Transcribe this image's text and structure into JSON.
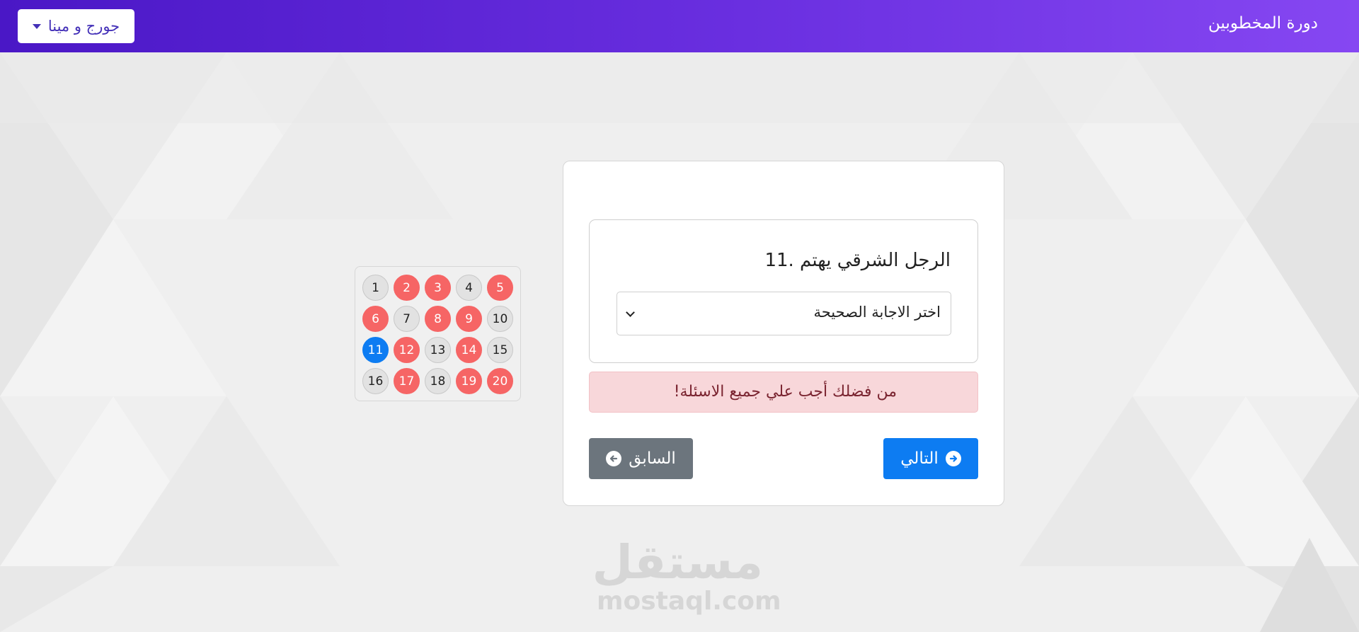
{
  "navbar": {
    "brand": "دورة المخطوبين",
    "user_menu_label": "جورج و مينا",
    "colors": {
      "start": "#4a17c6",
      "end": "#8647f2"
    }
  },
  "question_nav": {
    "numbers": [
      {
        "label": "1",
        "status": "unanswered"
      },
      {
        "label": "2",
        "status": "answered"
      },
      {
        "label": "3",
        "status": "answered"
      },
      {
        "label": "4",
        "status": "unanswered"
      },
      {
        "label": "5",
        "status": "answered"
      },
      {
        "label": "6",
        "status": "answered"
      },
      {
        "label": "7",
        "status": "unanswered"
      },
      {
        "label": "8",
        "status": "answered"
      },
      {
        "label": "9",
        "status": "answered"
      },
      {
        "label": "10",
        "status": "unanswered"
      },
      {
        "label": "11",
        "status": "current"
      },
      {
        "label": "12",
        "status": "answered"
      },
      {
        "label": "13",
        "status": "unanswered"
      },
      {
        "label": "14",
        "status": "answered"
      },
      {
        "label": "15",
        "status": "unanswered"
      },
      {
        "label": "16",
        "status": "unanswered"
      },
      {
        "label": "17",
        "status": "answered"
      },
      {
        "label": "18",
        "status": "unanswered"
      },
      {
        "label": "19",
        "status": "answered"
      },
      {
        "label": "20",
        "status": "answered"
      }
    ],
    "colors": {
      "answered": "#f66565",
      "current": "#0d7cf2",
      "unanswered": "#e2e2e2"
    }
  },
  "question": {
    "text": "الرجل الشرقي يهتم .11",
    "select_placeholder": "اختر الاجابة الصحيحة"
  },
  "alert": {
    "text": "من فضلك أجب علي جميع الاسئلة!"
  },
  "buttons": {
    "next_label": "التالي",
    "prev_label": "السابق",
    "next_icon": "arrow-circle-right-icon",
    "prev_icon": "arrow-circle-left-icon"
  },
  "watermark": {
    "arabic": "مستقل",
    "latin": "mostaql.com"
  }
}
